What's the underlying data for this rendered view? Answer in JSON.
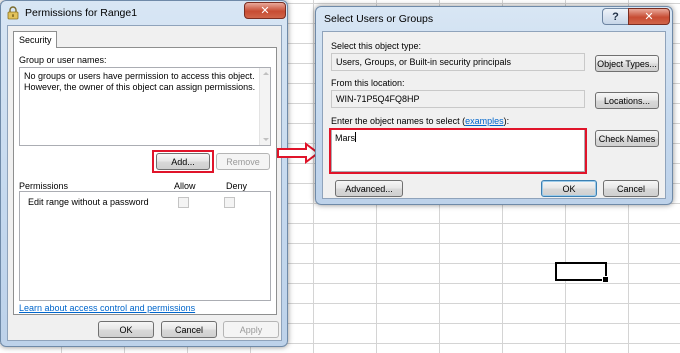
{
  "perm_dialog": {
    "title": "Permissions for Range1",
    "tab": "Security",
    "group_label": "Group or user names:",
    "group_message": "No groups or users have permission to access this object.  However, the owner of this object can assign permissions.",
    "add_button": "Add...",
    "remove_button": "Remove",
    "permissions_label": "Permissions",
    "allow_label": "Allow",
    "deny_label": "Deny",
    "permission_row": "Edit range without a password",
    "help_link": "Learn about access control and permissions",
    "ok_button": "OK",
    "cancel_button": "Cancel",
    "apply_button": "Apply",
    "close_glyph": "✕"
  },
  "select_dialog": {
    "title": "Select Users or Groups",
    "help_glyph": "?",
    "close_glyph": "✕",
    "object_type_label": "Select this object type:",
    "object_type_value": "Users, Groups, or Built-in security principals",
    "object_types_button": "Object Types...",
    "location_label": "From this location:",
    "location_value": "WIN-71P5Q4FQ8HP",
    "locations_button": "Locations...",
    "enter_label_prefix": "Enter the object names to select (",
    "examples_link": "examples",
    "enter_label_suffix": "):",
    "names_value": "Mars",
    "check_names_button": "Check Names",
    "advanced_button": "Advanced...",
    "ok_button": "OK",
    "cancel_button": "Cancel"
  },
  "colors": {
    "highlight": "#e0142a",
    "link": "#0066cc"
  },
  "icons": {
    "window_icon": "lock-icon",
    "annotation_arrow": "arrow-right-icon"
  }
}
